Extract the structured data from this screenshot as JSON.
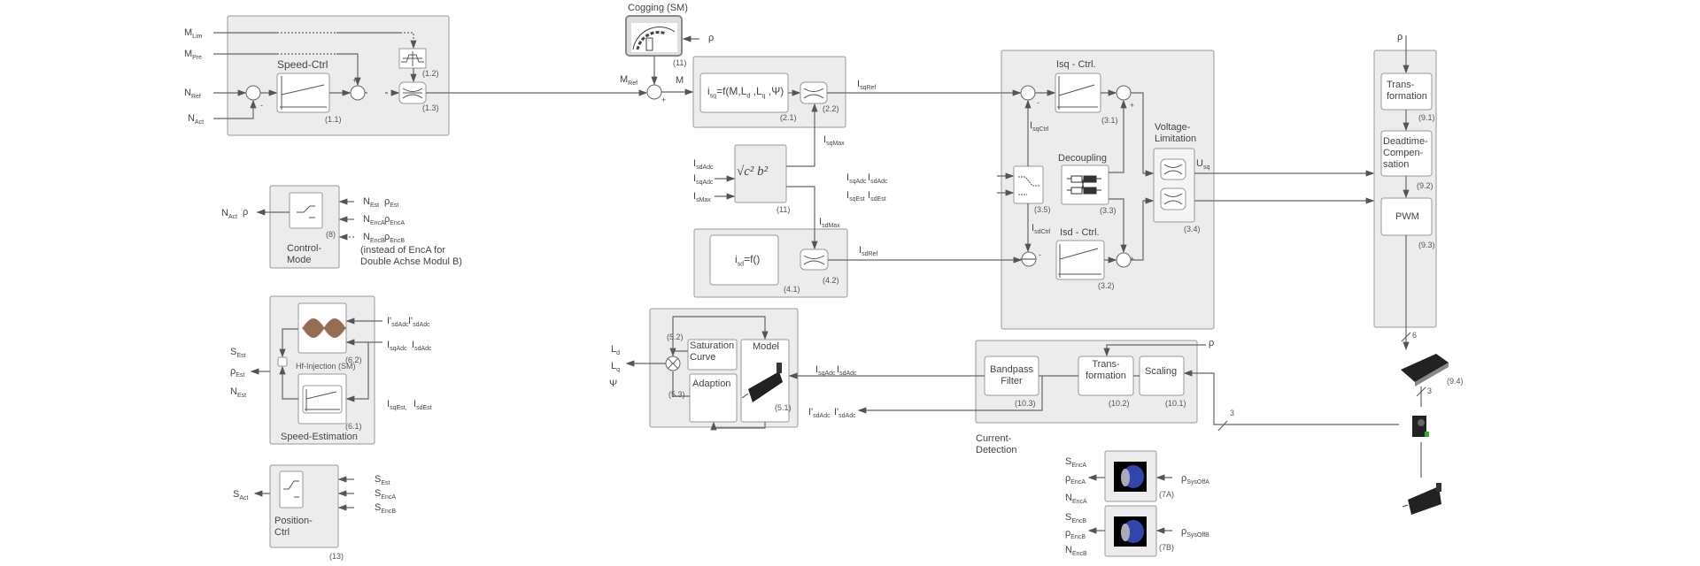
{
  "colors": {
    "group_fill": "#ececec",
    "group_stroke": "#999999",
    "block_fill": "#ffffff",
    "line": "#555555"
  },
  "blocks": {
    "speed_ctrl": {
      "title": "Speed-Ctrl",
      "id1": "(1.1)",
      "id2": "(1.2)",
      "id3": "(1.3)"
    },
    "cogging": {
      "title": "Cogging (SM)",
      "id": "(11)"
    },
    "torque": {
      "formula": {
        "a": "i",
        "a_s": "sq",
        "b": "=f(M,L",
        "b_s": "d",
        "c": " ,L",
        "c_s": "q",
        "d": " ,Ψ)"
      },
      "id1": "(2.1)",
      "id2": "(2.2)"
    },
    "sqrt": {
      "formula": "√c²   b²",
      "id": "(11)"
    },
    "isd": {
      "formula": {
        "a": "i",
        "a_s": "sd",
        "b": "=f()"
      },
      "id1": "(4.1)",
      "id2": "(4.2)"
    },
    "current_ctrl": {
      "isq_title": "Isq - Ctrl.",
      "isq_id": "(3.1)",
      "isd_title": "Isd - Ctrl.",
      "isd_id": "(3.2)",
      "decoupling_title": "Decoupling",
      "decoupling_id": "(3.3)",
      "vlim_title1": "Voltage-",
      "vlim_title2": "Limitation",
      "vlim_id": "(3.4)",
      "switch_id": "(3.5)"
    },
    "pwm_group": {
      "trans1": "Trans-",
      "trans2": "formation",
      "trans_id": "(9.1)",
      "dead1": "Deadtime-",
      "dead2": "Compen-",
      "dead3": "sation",
      "dead_id": "(9.2)",
      "pwm": "PWM",
      "pwm_id": "(9.3)",
      "igbt_id": "(9.4)",
      "bus6": "6",
      "bus3a": "3"
    },
    "current_detection": {
      "bandpass1": "Bandpass",
      "bandpass2": "Filter",
      "bandpass_id": "(10.3)",
      "trans1": "Trans-",
      "trans2": "formation",
      "trans_id": "(10.2)",
      "scaling": "Scaling",
      "scaling_id": "(10.1)",
      "title1": "Current-",
      "title2": "Detection",
      "bus3": "3"
    },
    "model": {
      "saturation1": "Saturation",
      "saturation2": "Curve",
      "saturation_id": "(5.2)",
      "adaption": "Adaption",
      "adaption_id": "(5.3)",
      "model": "Model",
      "model_id": "(5.1)"
    },
    "control_mode": {
      "title1": "Control-",
      "title2": "Mode",
      "id": "(8)",
      "note1": "(instead of EncA  for",
      "note2": "Double Achse Modul B)"
    },
    "speed_est": {
      "hf": "Hf-Injection (SM)",
      "hf_id": "(6.2)",
      "est_id": "(6.1)",
      "title": "Speed-Estimation"
    },
    "position": {
      "title1": "Position-",
      "title2": "Ctrl",
      "id": "(13)"
    },
    "encoders": {
      "a_id": "(7A)",
      "b_id": "(7B)"
    }
  },
  "sig": {
    "m_lim": {
      "m": "M",
      "s": "Lim"
    },
    "m_pre": {
      "m": "M",
      "s": "Pre"
    },
    "n_ref": {
      "m": "N",
      "s": "Ref"
    },
    "n_act": {
      "m": "N",
      "s": "Act"
    },
    "m_ref": {
      "m": "M",
      "s": "Ref"
    },
    "m": {
      "m": "M",
      "s": ""
    },
    "rho": {
      "m": "ρ",
      "s": ""
    },
    "plus": "+",
    "minus": "-",
    "i_sqref": {
      "m": "I",
      "s": "sqRef"
    },
    "i_sdadc": {
      "m": "I",
      "s": "sdAdc"
    },
    "i_sqadc": {
      "m": "I",
      "s": "sqAdc"
    },
    "i_smax": {
      "m": "I",
      "s": "sMax"
    },
    "i_sqmax": {
      "m": "I",
      "s": "sqMax"
    },
    "i_sdmax": {
      "m": "I",
      "s": "sdMax"
    },
    "i_sdref": {
      "m": "I",
      "s": "sdRef"
    },
    "i_sqest": {
      "m": "I",
      "s": "sqEst"
    },
    "i_sdest": {
      "m": "I",
      "s": "sdEst"
    },
    "i_sqctrl": {
      "m": "I",
      "s": "sqCtrl"
    },
    "i_sdctrl": {
      "m": "I",
      "s": "sdCtrl"
    },
    "u_sq": {
      "m": "U",
      "s": "sq"
    },
    "n_est": {
      "m": "N",
      "s": "Est"
    },
    "rho_est": {
      "m": "ρ",
      "s": "Est"
    },
    "n_enca": {
      "m": "N",
      "s": "EncA"
    },
    "rho_enca": {
      "m": "ρ",
      "s": "EncA"
    },
    "n_encb": {
      "m": "N",
      "s": "EncB"
    },
    "rho_encb": {
      "m": "ρ",
      "s": "EncB"
    },
    "s_est": {
      "m": "S",
      "s": "Est"
    },
    "s_enca": {
      "m": "S",
      "s": "EncA"
    },
    "s_encb": {
      "m": "S",
      "s": "EncB"
    },
    "s_act": {
      "m": "S",
      "s": "Act"
    },
    "ip_sdadc": {
      "m": "I'",
      "s": "sdAdc"
    },
    "i_sqest_c": {
      "m": "I",
      "s": "sqEst,"
    },
    "i_sqadc_c": {
      "m": "I",
      "s": "sqAdc"
    },
    "l_d": {
      "m": "L",
      "s": "d"
    },
    "l_q": {
      "m": "L",
      "s": "q"
    },
    "psi": {
      "m": "Ψ",
      "s": ""
    },
    "rho_sysoffa": {
      "m": "ρ",
      "s": "SysOffA"
    },
    "rho_sysoffb": {
      "m": "ρ",
      "s": "SysOffB"
    }
  },
  "icons": [
    "pi-controller-icon",
    "limiter-icon",
    "ramp-limit-icon",
    "sum-junction-icon",
    "cogging-motor-icon",
    "switch-icon",
    "decoupling-icon",
    "hf-signal-icon",
    "multiplier-icon",
    "servo-motor-icon",
    "igbt-module-icon",
    "current-sensor-icon",
    "encoder-icon"
  ]
}
